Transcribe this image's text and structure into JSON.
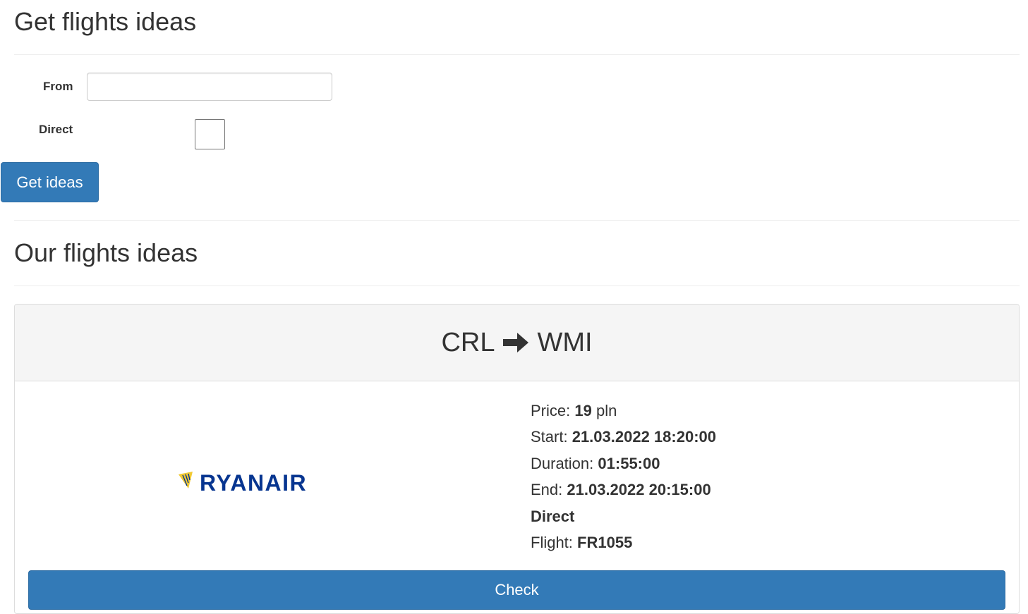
{
  "search": {
    "title": "Get flights ideas",
    "from_label": "From",
    "from_value": "",
    "from_placeholder": "",
    "direct_label": "Direct",
    "direct_checked": false,
    "submit_label": "Get ideas"
  },
  "results": {
    "title": "Our flights ideas",
    "flights": [
      {
        "origin": "CRL",
        "destination": "WMI",
        "airline_logo": "RYANAIR",
        "price_label": "Price:",
        "price_value": "19",
        "price_unit": "pln",
        "start_label": "Start:",
        "start_value": "21.03.2022 18:20:00",
        "duration_label": "Duration:",
        "duration_value": "01:55:00",
        "end_label": "End:",
        "end_value": "21.03.2022 20:15:00",
        "direct_text": "Direct",
        "flight_label": "Flight:",
        "flight_value": "FR1055",
        "action_label": "Check"
      }
    ]
  },
  "colors": {
    "primary": "#337ab7",
    "ryanair_blue": "#073590",
    "ryanair_yellow": "#f1c933"
  },
  "icons": {
    "route_arrow": "arrow-right-icon"
  }
}
